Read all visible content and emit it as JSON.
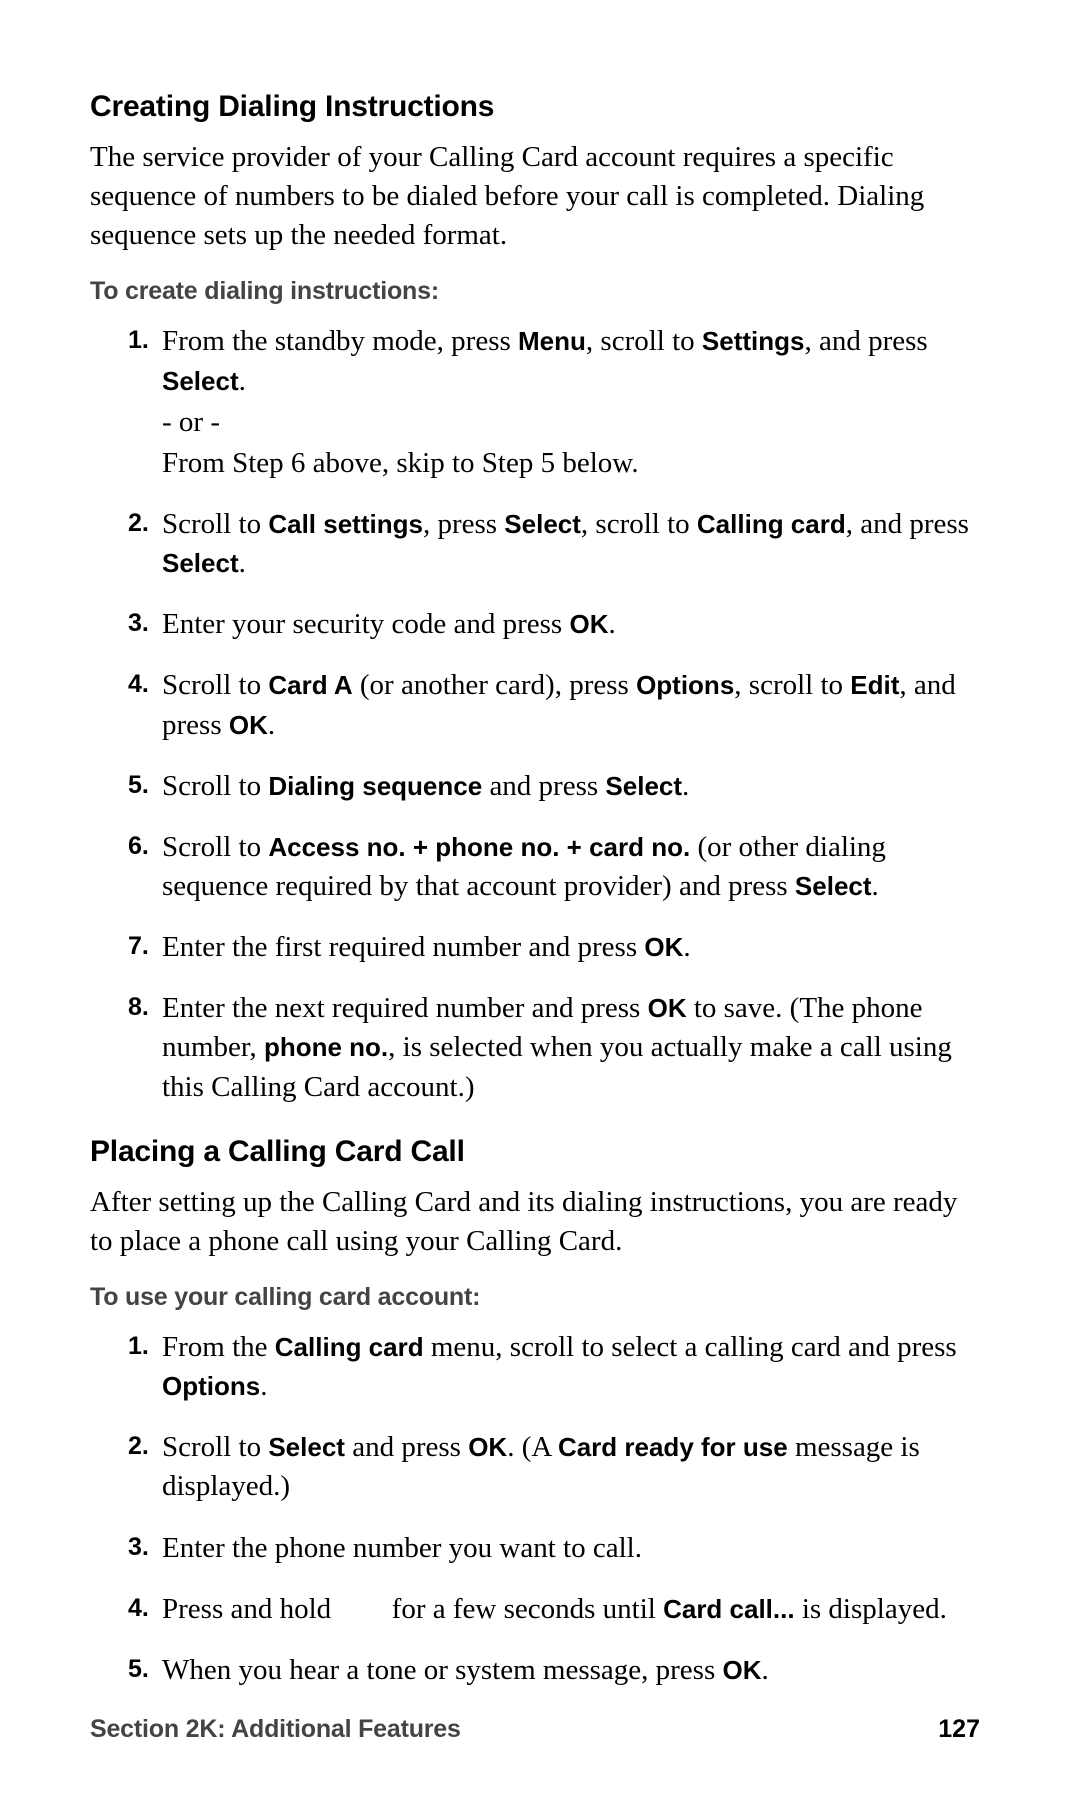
{
  "sections": [
    {
      "heading": "Creating Dialing Instructions",
      "intro": "The service provider of your Calling Card account requires a specific sequence of numbers to be dialed before your call is completed. Dialing sequence sets up the needed format.",
      "subhead": "To create dialing instructions:",
      "steps": [
        {
          "num": "1.",
          "runs": [
            {
              "t": "From the standby mode, press "
            },
            {
              "t": "Menu",
              "b": true
            },
            {
              "t": ", scroll to "
            },
            {
              "t": "Settings",
              "b": true
            },
            {
              "t": ", and press "
            },
            {
              "t": "Select",
              "b": true
            },
            {
              "t": "."
            },
            {
              "br": true
            },
            {
              "t": "- or -"
            },
            {
              "br": true
            },
            {
              "t": "From Step 6 above, skip to Step 5 below."
            }
          ]
        },
        {
          "num": "2.",
          "runs": [
            {
              "t": "Scroll to "
            },
            {
              "t": "Call settings",
              "b": true
            },
            {
              "t": ", press "
            },
            {
              "t": "Select",
              "b": true
            },
            {
              "t": ", scroll to "
            },
            {
              "t": "Calling card",
              "b": true
            },
            {
              "t": ", and press "
            },
            {
              "t": "Select",
              "b": true
            },
            {
              "t": "."
            }
          ]
        },
        {
          "num": "3.",
          "runs": [
            {
              "t": "Enter your security code and press "
            },
            {
              "t": "OK",
              "b": true
            },
            {
              "t": "."
            }
          ]
        },
        {
          "num": "4.",
          "runs": [
            {
              "t": "Scroll to "
            },
            {
              "t": "Card A",
              "b": true
            },
            {
              "t": " (or another card), press "
            },
            {
              "t": "Options",
              "b": true
            },
            {
              "t": ", scroll to "
            },
            {
              "t": "Edit",
              "b": true
            },
            {
              "t": ", and press "
            },
            {
              "t": "OK",
              "b": true
            },
            {
              "t": "."
            }
          ]
        },
        {
          "num": "5.",
          "runs": [
            {
              "t": "Scroll to "
            },
            {
              "t": "Dialing sequence",
              "b": true
            },
            {
              "t": " and press "
            },
            {
              "t": "Select",
              "b": true
            },
            {
              "t": "."
            }
          ]
        },
        {
          "num": "6.",
          "runs": [
            {
              "t": "Scroll to "
            },
            {
              "t": "Access no. + phone no. + card no.",
              "b": true
            },
            {
              "t": " (or other dialing sequence required by that account provider) and press "
            },
            {
              "t": "Select",
              "b": true
            },
            {
              "t": "."
            }
          ]
        },
        {
          "num": "7.",
          "runs": [
            {
              "t": "Enter the first required number and press "
            },
            {
              "t": "OK",
              "b": true
            },
            {
              "t": "."
            }
          ]
        },
        {
          "num": "8.",
          "runs": [
            {
              "t": "Enter the next required number and press "
            },
            {
              "t": "OK",
              "b": true
            },
            {
              "t": " to save. (The phone number, "
            },
            {
              "t": "phone no.",
              "b": true
            },
            {
              "t": ", is selected when you actually make a call using this Calling Card account.)"
            }
          ]
        }
      ]
    },
    {
      "heading": "Placing a Calling Card Call",
      "intro": "After setting up the Calling Card and its dialing instructions, you are ready to place a phone call using your Calling Card.",
      "subhead": "To use your calling card account:",
      "steps": [
        {
          "num": "1.",
          "runs": [
            {
              "t": "From the "
            },
            {
              "t": "Calling card",
              "b": true
            },
            {
              "t": " menu, scroll to select a calling card and press "
            },
            {
              "t": "Options",
              "b": true
            },
            {
              "t": "."
            }
          ]
        },
        {
          "num": "2.",
          "runs": [
            {
              "t": "Scroll to "
            },
            {
              "t": "Select",
              "b": true
            },
            {
              "t": " and press "
            },
            {
              "t": "OK",
              "b": true
            },
            {
              "t": ". (A "
            },
            {
              "t": "Card ready for use",
              "b": true
            },
            {
              "t": " message is displayed.)"
            }
          ]
        },
        {
          "num": "3.",
          "runs": [
            {
              "t": "Enter the phone number you want to call."
            }
          ]
        },
        {
          "num": "4.",
          "runs": [
            {
              "t": "Press and hold "
            },
            {
              "gap": true
            },
            {
              "t": " for a few seconds until "
            },
            {
              "t": "Card call...",
              "b": true
            },
            {
              "t": " is displayed."
            }
          ]
        },
        {
          "num": "5.",
          "runs": [
            {
              "t": "When you hear a tone or system message, press "
            },
            {
              "t": "OK",
              "b": true
            },
            {
              "t": "."
            }
          ]
        }
      ]
    }
  ],
  "footer": {
    "left": "Section 2K: Additional Features",
    "right": "127"
  }
}
